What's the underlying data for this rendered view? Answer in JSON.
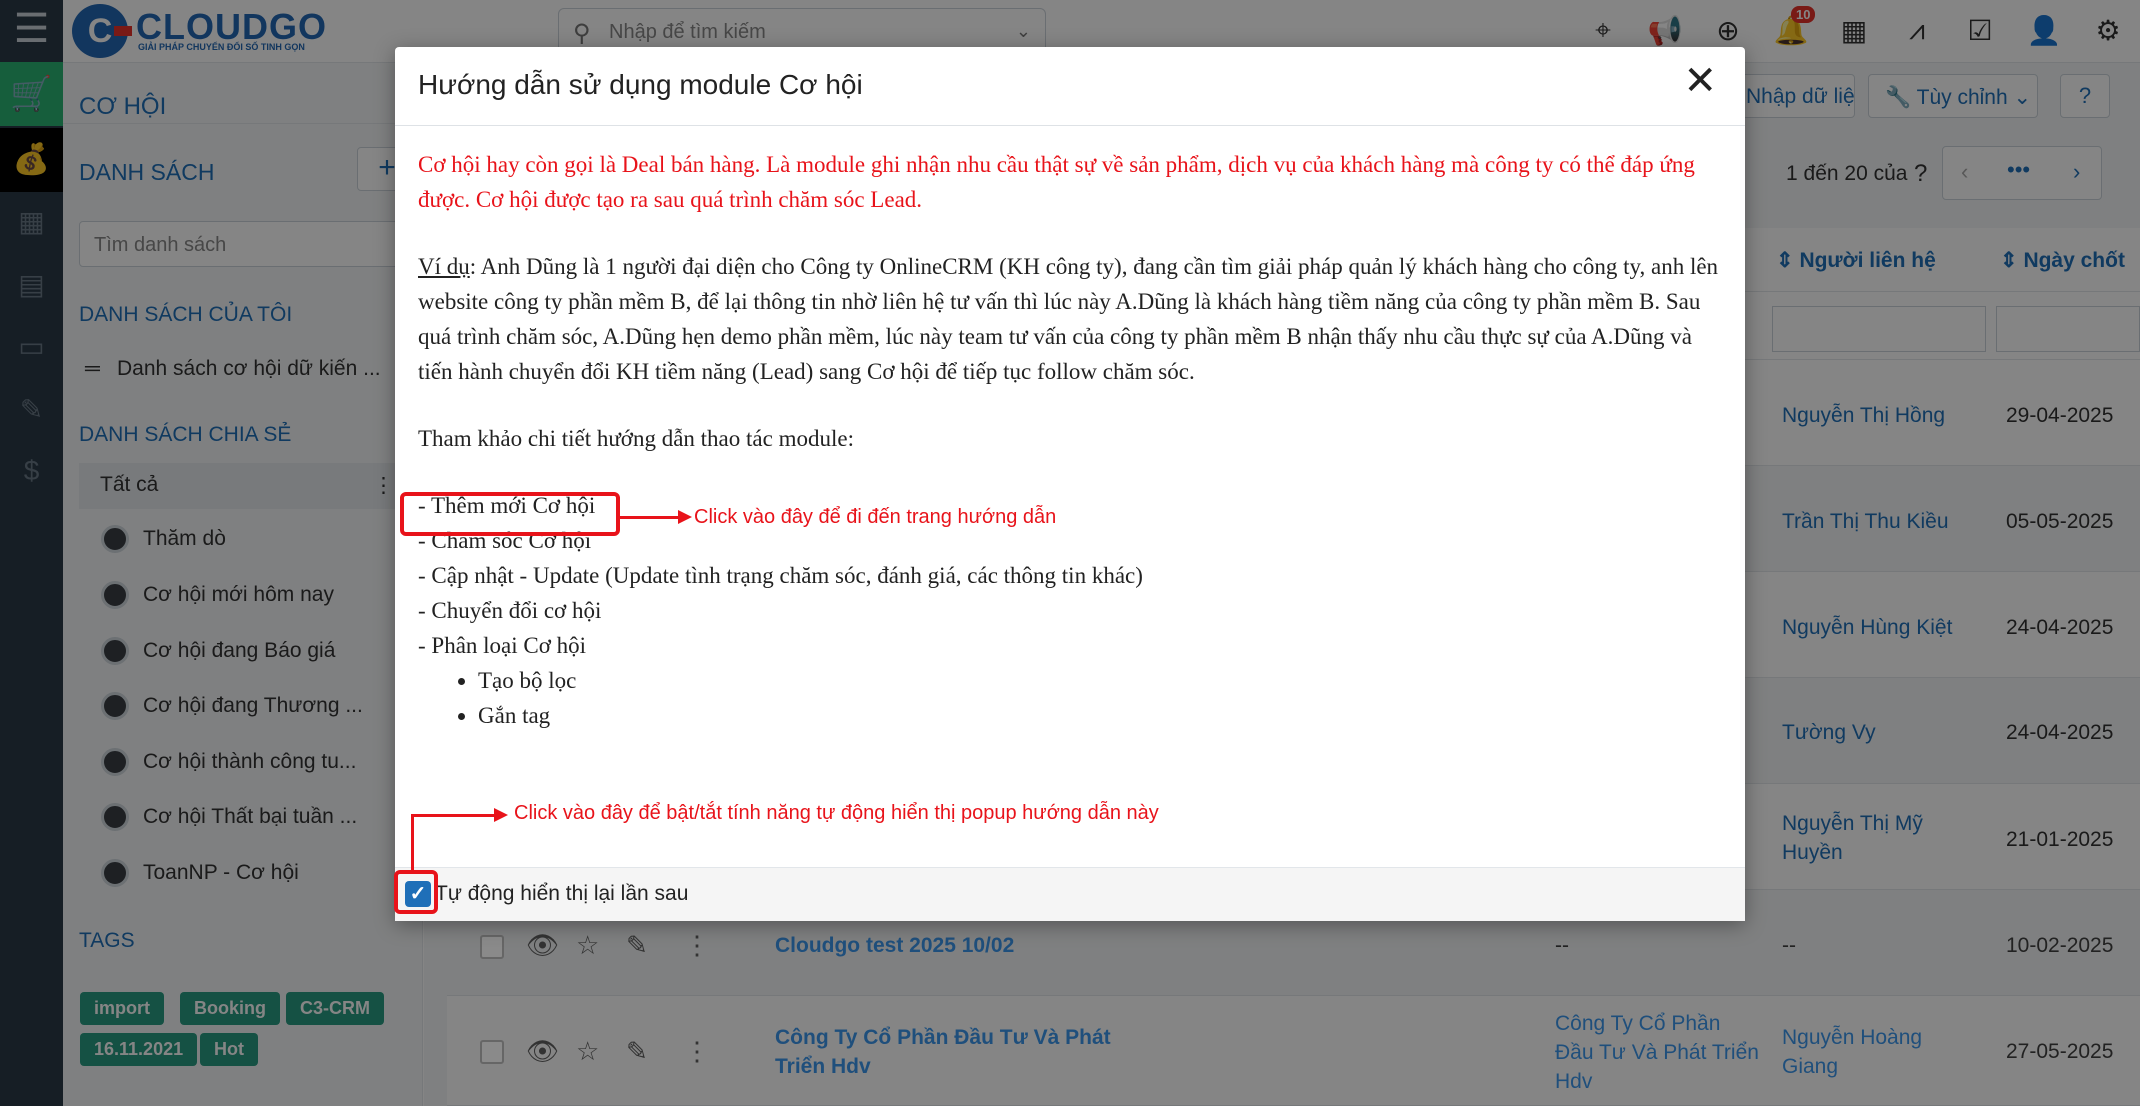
{
  "app": {
    "brand": "CLOUDGO",
    "brand_tagline": "GIẢI PHÁP CHUYỂN ĐỔI SỐ TINH GỌN",
    "search_placeholder": "Nhập để tìm kiếm",
    "notification_count": "10"
  },
  "page": {
    "module_title": "CƠ HỘI",
    "btn_import": "Nhập dữ liệu",
    "btn_customize": "Tùy chỉnh",
    "pagination": "1 đến 20 của"
  },
  "sidebar": {
    "list_title": "DANH SÁCH",
    "list_search_placeholder": "Tìm danh sách",
    "my_lists_title": "DANH SÁCH CỦA TÔI",
    "my_list_item": "Danh sách cơ hội dữ kiến ...",
    "shared_title": "DANH SÁCH CHIA SẺ",
    "shared_all": "Tất cả",
    "shared_items": [
      "Thăm dò",
      "Cơ hội mới hôm nay",
      "Cơ hội đang Báo giá",
      "Cơ hội đang Thương ...",
      "Cơ hội thành công tu...",
      "Cơ hội Thất bại tuần ...",
      "ToanNP - Cơ hội"
    ],
    "tags_title": "TAGS",
    "tags": [
      "import",
      "Booking",
      "C3-CRM",
      "16.11.2021",
      "Hot"
    ]
  },
  "table": {
    "col_contact": "Người liên hệ",
    "col_close_date": "Ngày chốt",
    "rows": [
      {
        "contact": "Nguyễn Thị Hồng",
        "date": "29-04-2025"
      },
      {
        "contact": "Trần Thị Thu Kiều",
        "date": "05-05-2025"
      },
      {
        "contact": "Nguyễn Hùng Kiệt",
        "date": "24-04-2025"
      },
      {
        "contact": "Tường Vy",
        "date": "24-04-2025"
      },
      {
        "contact": "Nguyễn Thị Mỹ",
        "contact2": "Huyền",
        "date": "21-01-2025"
      },
      {
        "name": "Cloudgo test 2025 10/02",
        "org": "--",
        "contact": "--",
        "date": "10-02-2025"
      },
      {
        "name": "Công Ty Cổ Phần Đầu Tư Và Phát",
        "name2": "Triển Hdv",
        "org": "Công Ty Cổ Phần",
        "org2": "Đầu Tư Và Phát Triển",
        "org3": "Hdv",
        "contact": "Nguyễn Hoàng",
        "contact2": "Giang",
        "date": "27-05-2025"
      }
    ]
  },
  "modal": {
    "title": "Hướng dẫn sử dụng module Cơ hội",
    "intro": "Cơ hội hay còn gọi là Deal bán hàng. Là module ghi nhận nhu cầu thật sự về sản phẩm, dịch vụ của khách hàng mà công ty có thể đáp ứng được. Cơ hội được tạo ra sau quá trình chăm sóc Lead.",
    "example_label": "Ví dụ",
    "example_text": ": Anh Dũng là 1 người đại diện cho Công ty OnlineCRM (KH công ty), đang cần tìm giải pháp quản lý khách hàng cho công ty, anh lên website công ty phần mềm B, để lại thông tin nhờ liên hệ tư vấn thì lúc này A.Dũng là khách hàng tiềm năng của công ty phần mềm B. Sau quá trình chăm sóc, A.Dũng hẹn demo phần mềm, lúc này team tư vấn của công ty phần mềm B nhận thấy nhu cầu thực sự của A.Dũng và tiến hành chuyển đổi KH tiềm năng (Lead) sang Cơ hội để tiếp tục follow chăm sóc.",
    "reference": "Tham khảo chi tiết hướng dẫn thao tác module:",
    "steps": [
      "- Thêm mới Cơ hội",
      "- Chăm sóc Cơ hội",
      "- Cập nhật - Update (Update tình trạng chăm sóc, đánh giá, các thông tin khác)",
      "- Chuyển đổi cơ hội",
      "- Phân loại Cơ hội"
    ],
    "sub_steps": [
      "Tạo bộ lọc",
      "Gắn tag"
    ],
    "auto_show_label": "Tự động hiển thị lại lần sau",
    "auto_show_checked": true
  },
  "annotations": {
    "add_new_note": "Click vào đây để đi đến trang hướng dẫn",
    "toggle_note": "Click vào đây để bật/tắt tính năng tự động hiển thị popup hướng dẫn này"
  },
  "colors": {
    "accent": "#1f6fb8",
    "annotation": "#e8131a",
    "tag": "#2a9b82",
    "sidebar_dark": "#2b3a47"
  }
}
